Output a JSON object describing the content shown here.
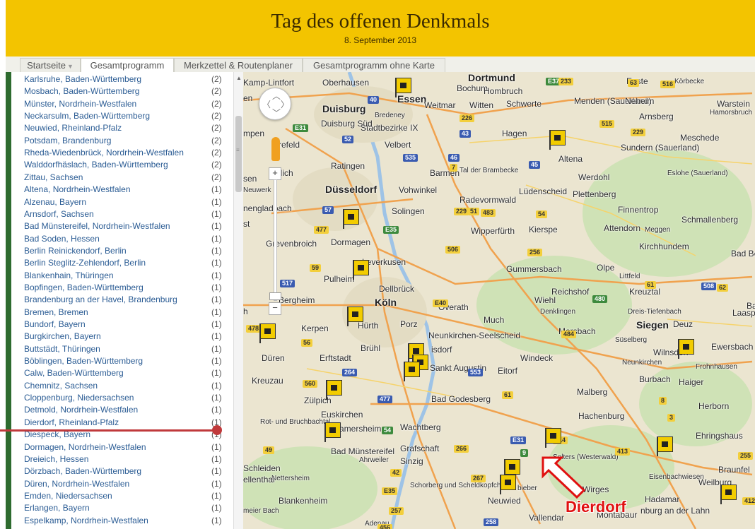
{
  "header": {
    "title": "Tag des offenen Denkmals",
    "subtitle": "8. September 2013"
  },
  "tabs": [
    {
      "label": "Startseite",
      "dropdown": true
    },
    {
      "label": "Gesamtprogramm",
      "active": true
    },
    {
      "label": "Merkzettel & Routenplaner"
    },
    {
      "label": "Gesamtprogramm ohne Karte"
    }
  ],
  "places": [
    {
      "name": "Karlsruhe, Baden-Württemberg",
      "count": "(2)"
    },
    {
      "name": "Mosbach, Baden-Württemberg",
      "count": "(2)"
    },
    {
      "name": "Münster, Nordrhein-Westfalen",
      "count": "(2)"
    },
    {
      "name": "Neckarsulm, Baden-Württemberg",
      "count": "(2)"
    },
    {
      "name": "Neuwied, Rheinland-Pfalz",
      "count": "(2)"
    },
    {
      "name": "Potsdam, Brandenburg",
      "count": "(2)"
    },
    {
      "name": "Rheda-Wiedenbrück, Nordrhein-Westfalen",
      "count": "(2)"
    },
    {
      "name": "Walddorfhäslach, Baden-Württemberg",
      "count": "(2)"
    },
    {
      "name": "Zittau, Sachsen",
      "count": "(2)"
    },
    {
      "name": "Altena, Nordrhein-Westfalen",
      "count": "(1)"
    },
    {
      "name": "Alzenau, Bayern",
      "count": "(1)"
    },
    {
      "name": "Arnsdorf, Sachsen",
      "count": "(1)"
    },
    {
      "name": "Bad Münstereifel, Nordrhein-Westfalen",
      "count": "(1)"
    },
    {
      "name": "Bad Soden, Hessen",
      "count": "(1)"
    },
    {
      "name": "Berlin Reinickendorf, Berlin",
      "count": "(1)"
    },
    {
      "name": "Berlin Steglitz-Zehlendorf, Berlin",
      "count": "(1)"
    },
    {
      "name": "Blankenhain, Thüringen",
      "count": "(1)"
    },
    {
      "name": "Bopfingen, Baden-Württemberg",
      "count": "(1)"
    },
    {
      "name": "Brandenburg an der Havel, Brandenburg",
      "count": "(1)"
    },
    {
      "name": "Bremen, Bremen",
      "count": "(1)"
    },
    {
      "name": "Bundorf, Bayern",
      "count": "(1)"
    },
    {
      "name": "Burgkirchen, Bayern",
      "count": "(1)"
    },
    {
      "name": "Buttstädt, Thüringen",
      "count": "(1)"
    },
    {
      "name": "Böblingen, Baden-Württemberg",
      "count": "(1)"
    },
    {
      "name": "Calw, Baden-Württemberg",
      "count": "(1)"
    },
    {
      "name": "Chemnitz, Sachsen",
      "count": "(1)"
    },
    {
      "name": "Cloppenburg, Niedersachsen",
      "count": "(1)"
    },
    {
      "name": "Detmold, Nordrhein-Westfalen",
      "count": "(1)"
    },
    {
      "name": "Dierdorf, Rheinland-Pfalz",
      "count": "(1)"
    },
    {
      "name": "Diespeck, Bayern",
      "count": "(1)"
    },
    {
      "name": "Dormagen, Nordrhein-Westfalen",
      "count": "(1)"
    },
    {
      "name": "Dreieich, Hessen",
      "count": "(1)"
    },
    {
      "name": "Dörzbach, Baden-Württemberg",
      "count": "(1)"
    },
    {
      "name": "Düren, Nordrhein-Westfalen",
      "count": "(1)"
    },
    {
      "name": "Emden, Niedersachsen",
      "count": "(1)"
    },
    {
      "name": "Erlangen, Bayern",
      "count": "(1)"
    },
    {
      "name": "Espelkamp, Nordrhein-Westfalen",
      "count": "(1)"
    }
  ],
  "map": {
    "annotation": "Dierdorf",
    "annotation_color": "#e01010",
    "labels": {
      "kamp_lintfort": "Kamp-Lintfort",
      "oberhausen": "Oberhausen",
      "essen": "Essen",
      "dortmund": "Dortmund",
      "bochum": "Bochum",
      "hombruch": "Hombruch",
      "weitmar": "Weitmar",
      "witten": "Witten",
      "schwerte": "Schwerte",
      "menden": "Menden (Sauerland)",
      "neheim": "Neheim",
      "arnsberg": "Arnsberg",
      "warstein": "Warstein",
      "hamorsbruch": "Hamorsbruch",
      "enste": "Enste",
      "korbecke": "Körbecke",
      "duisburg": "Duisburg",
      "bredeney": "Bredeney",
      "stadtbezirke": "Stadtbezirke IX",
      "duisburg_sud": "Duisburg Süd",
      "hagen": "Hagen",
      "velbert": "Velbert",
      "krefeld": "Krefeld",
      "ratingen": "Ratingen",
      "altena": "Altena",
      "sundern": "Sundern (Sauerland)",
      "meschede": "Meschede",
      "barmen": "Barmen",
      "tal_der": "Tal der Brambecke",
      "werdohl": "Werdohl",
      "eslohe": "Eslohe (Sauerland)",
      "neuwerk": "Neuwerk",
      "dusseldorf": "Düsseldorf",
      "vohwinkel": "Vohwinkel",
      "ludenscheid": "Lüdenscheid",
      "plettenberg": "Plettenberg",
      "radevormwald": "Radevormwald",
      "gladbach": "nengladbach",
      "solingen": "Solingen",
      "finnentrop": "Finnentrop",
      "schmallenberg": "Schmallenberg",
      "attendorn": "Attendorn",
      "meggen": "Meggen",
      "wipperfurth": "Wipperfürth",
      "kierspe": "Kierspe",
      "grevenbroich": "Grevenbroich",
      "dormagen": "Dormagen",
      "kirchhundem": "Kirchhundem",
      "leverkusen": "Leverkusen",
      "gummersbach": "Gummersbach",
      "olpe": "Olpe",
      "bad_berleburg": "Bad Berlebur",
      "pulheim": "Pulheim",
      "dellbruck": "Dellbrück",
      "littfeld": "Littfeld",
      "reichshof": "Reichshof",
      "kreuztal": "Kreuztal",
      "bergheim": "Bergheim",
      "koln": "Köln",
      "overath": "Overath",
      "wiehl": "Wiehl",
      "much": "Much",
      "denklingen": "Denklingen",
      "dreis": "Dreis-Tiefenbach",
      "laasp": "Laasp",
      "kerpen": "Kerpen",
      "hurth": "Hürth",
      "porz": "Porz",
      "neunkirchen": "Neunkirchen-Seelscheid",
      "morsbach": "Morsbach",
      "siegen": "Siegen",
      "deuz": "Deuz",
      "suselberg": "Süselberg",
      "wilnsdorf": "Wilnsdorf",
      "ewersbach": "Ewersbach",
      "bruhl": "Brühl",
      "troisdorf": "isdorf",
      "windeck": "Windeck",
      "neunkirchen2": "Neunkirchen",
      "frohnhausen": "Frohnhausen",
      "duren": "Düren",
      "erftstadt": "Erftstadt",
      "sankt": "Sankt Augustin",
      "eitorf": "Eitorf",
      "burbach": "Burbach",
      "haiger": "Haiger",
      "kreuzau": "Kreuzau",
      "malberg": "Malberg",
      "zulpich": "Zülpich",
      "bad_godesberg": "Bad Godesberg",
      "euskirchen": "Euskirchen",
      "hachenburg": "Hachenburg",
      "herborn": "Herborn",
      "rot_und": "Rot- und Bruchbachtal",
      "amersheim": "amersheim",
      "wachtberg": "Wachtberg",
      "ehringshaus": "Ehringshaus",
      "bad_munstereifel": "Bad Münstereifel",
      "grafschaft": "Grafschaft",
      "schleiden": "Schleiden",
      "ahrweiler": "Ahrweiler",
      "sinzig": "Sinzig",
      "selters": "Selters (Westerwald)",
      "braunfel": "Braunfel",
      "eisenbachwiesen": "Eisenbachwiesen",
      "weilburg": "Weilburg",
      "nettersheim": "Nettersheim",
      "ellenthal": "ellenthal",
      "schorberg": "Schorberg und Scheldkopfchen",
      "biber": "bieber",
      "wirges": "Wirges",
      "hadamar": "Hadamar",
      "blankenheim": "Blankenheim",
      "neuwied": "Neuwied",
      "montabaur": "Montabaur",
      "limburg": "nburg an der Lahn",
      "meier": "meier Bach",
      "adenau": "Adenau",
      "vallendar": "Vallendar",
      "lich": "llich",
      "sen": "sen",
      "mpen": "mpen",
      "st": "st",
      "en": "en",
      "h": "h",
      "bac": "Bac"
    },
    "shields": [
      "E37",
      "233",
      "63",
      "516",
      "40",
      "226",
      "E31",
      "43",
      "515",
      "229",
      "52",
      "535",
      "46",
      "7",
      "45",
      "57",
      "229",
      "51",
      "483",
      "54",
      "477",
      "E35",
      "506",
      "256",
      "59",
      "517",
      "61",
      "508",
      "62",
      "480",
      "E40",
      "484",
      "478",
      "56",
      "264",
      "553",
      "560",
      "477",
      "61",
      "8",
      "54",
      "E31",
      "3",
      "414",
      "413",
      "255",
      "49",
      "266",
      "42",
      "267",
      "9",
      "E35",
      "257",
      "412",
      "456",
      "258",
      "61"
    ]
  }
}
